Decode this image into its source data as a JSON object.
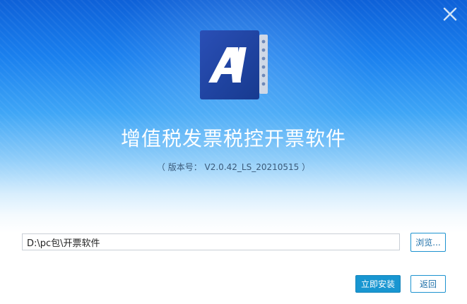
{
  "window": {
    "title": "增值税发票税控开票软件",
    "version": "（ 版本号： V2.0.42_LS_20210515 ）"
  },
  "logo": {
    "letter": "A",
    "icon": "app-logo-icon"
  },
  "close": {
    "icon": "close-icon"
  },
  "install_path": {
    "value": "D:\\pc包\\开票软件"
  },
  "buttons": {
    "browse": "浏览...",
    "install": "立即安装",
    "back": "返回"
  },
  "colors": {
    "accent": "#1896d1",
    "header_top": "#0e61d8",
    "logo_bg": "#1f3f9a"
  }
}
